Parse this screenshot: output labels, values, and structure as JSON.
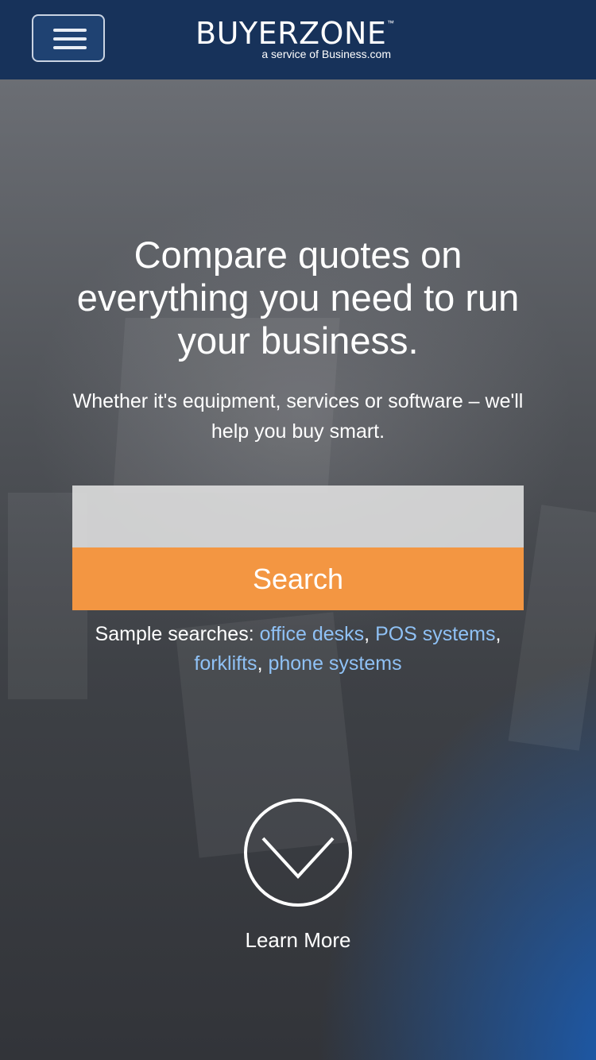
{
  "header": {
    "menu_icon": "hamburger-icon",
    "logo_text": "BUYERZONE",
    "logo_trademark": "™",
    "logo_subtitle": "a service of Business.com",
    "background_color": "#17325a",
    "accent_color": "#2f80d1"
  },
  "hero": {
    "headline": "Compare quotes on everything you need to run your business.",
    "subheadline": "Whether it's equipment, services or software – we'll help you buy smart.",
    "search": {
      "placeholder": "",
      "value": "",
      "button_label": "Search",
      "button_color": "#f39642"
    },
    "samples": {
      "prefix": "Sample searches: ",
      "links": [
        "office desks",
        "POS systems",
        "forklifts",
        "phone systems"
      ],
      "link_color": "#8fc1f5"
    },
    "learn_more": {
      "icon": "chevron-down-circle-icon",
      "label": "Learn More"
    }
  }
}
